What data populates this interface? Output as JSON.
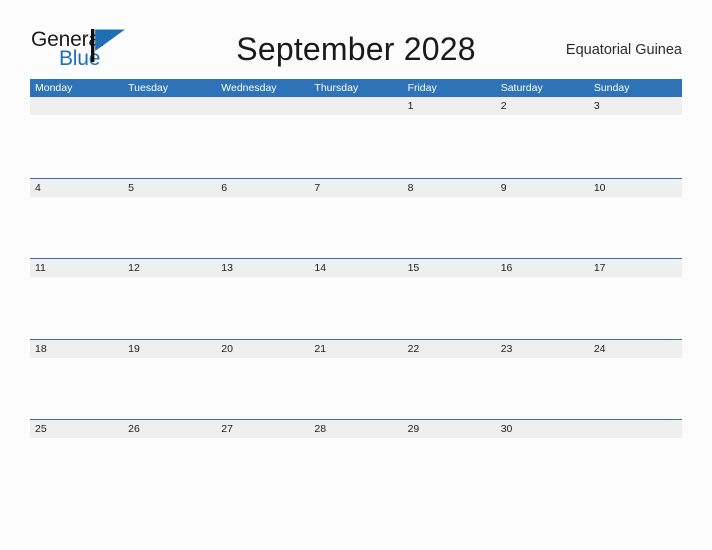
{
  "brand": {
    "name_part1": "General",
    "name_part2": "Blue",
    "logo_icon": "flag-triangle-icon",
    "accent_color": "#1f6fb5"
  },
  "header": {
    "title": "September 2028",
    "locale": "Equatorial Guinea"
  },
  "calendar": {
    "header_color": "#2e72b8",
    "band_color": "#efefef",
    "weekdays": [
      "Monday",
      "Tuesday",
      "Wednesday",
      "Thursday",
      "Friday",
      "Saturday",
      "Sunday"
    ],
    "weeks": [
      [
        "",
        "",
        "",
        "",
        "1",
        "2",
        "3"
      ],
      [
        "4",
        "5",
        "6",
        "7",
        "8",
        "9",
        "10"
      ],
      [
        "11",
        "12",
        "13",
        "14",
        "15",
        "16",
        "17"
      ],
      [
        "18",
        "19",
        "20",
        "21",
        "22",
        "23",
        "24"
      ],
      [
        "25",
        "26",
        "27",
        "28",
        "29",
        "30",
        ""
      ]
    ]
  }
}
